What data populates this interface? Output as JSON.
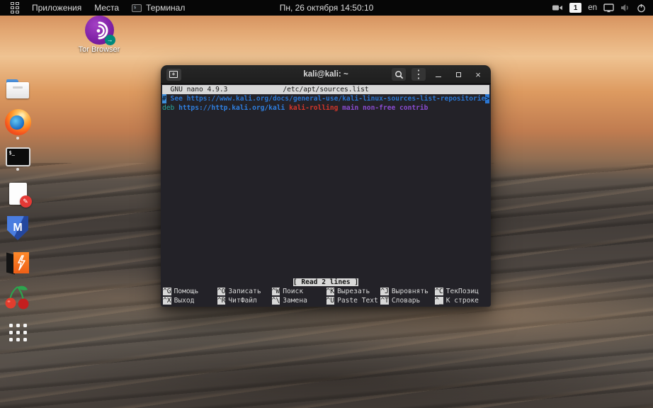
{
  "topbar": {
    "menus": [
      {
        "label": "Приложения"
      },
      {
        "label": "Места"
      },
      {
        "label": "Терминал"
      }
    ],
    "clock": "Пн, 26 октября 14:50:10",
    "workspace": "1",
    "keyboard_layout": "en"
  },
  "desktop_icon": {
    "label": "Tor Browser"
  },
  "window": {
    "title": "kali@kali: ~"
  },
  "icons": {
    "kebab": "⋮",
    "close": "×",
    "plus": "+",
    "terminal_prompt": "$_",
    "mini_prompt": "$",
    "pencil": "✎",
    "tor_arrow": "→",
    "metasploit_letter": "M"
  },
  "nano": {
    "version": "GNU nano 4.9.3",
    "filename": "/etc/apt/sources.list",
    "line1": {
      "cursor_char": "#",
      "text": " See https://www.kali.org/docs/general-use/kali-linux-sources-list-repositorie",
      "overflow": ">"
    },
    "line2": [
      {
        "text": "deb "
      },
      {
        "text": "https://http.kali.org/kali "
      },
      {
        "text": "kali-rolling "
      },
      {
        "text": "main non-free contrib"
      }
    ],
    "status": "[ Read 2 lines ]",
    "shortcuts": [
      {
        "key": "^G",
        "label": "Помощь"
      },
      {
        "key": "^O",
        "label": "Записать"
      },
      {
        "key": "^W",
        "label": "Поиск"
      },
      {
        "key": "^K",
        "label": "Вырезать"
      },
      {
        "key": "^J",
        "label": "Выровнять"
      },
      {
        "key": "^C",
        "label": "ТекПозиц"
      },
      {
        "key": "^X",
        "label": "Выход"
      },
      {
        "key": "^R",
        "label": "ЧитФайл"
      },
      {
        "key": "^\\",
        "label": "Замена"
      },
      {
        "key": "^U",
        "label": "Paste Text"
      },
      {
        "key": "^T",
        "label": "Словарь"
      },
      {
        "key": "^_",
        "label": "К строке"
      }
    ]
  },
  "colors": {
    "comment_blue": "#2a76d2",
    "deb_teal": "#2aa79b",
    "url_blue": "#2f7fe0",
    "suite_red": "#d4362a",
    "components_purple": "#8a4bd0",
    "nano_bar_bg": "#d8d8d8",
    "terminal_bg": "#232228",
    "topbar_bg": "#060606",
    "sky_orange": "#e3a873"
  }
}
